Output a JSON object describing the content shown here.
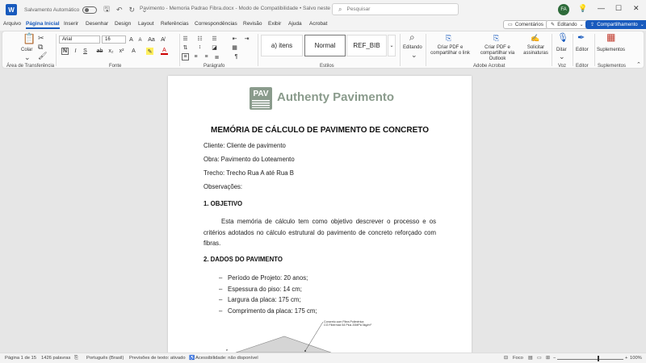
{
  "titlebar": {
    "autosave": "Salvamento Automático",
    "doc_title": "Pavimento - Memoria Padrao Fibra.docx  -  Modo de Compatibilidade • Salvo neste PC",
    "search_placeholder": "Pesquisar",
    "avatar_initials": "FA"
  },
  "tabs": [
    "Arquivo",
    "Página Inicial",
    "Inserir",
    "Desenhar",
    "Design",
    "Layout",
    "Referências",
    "Correspondências",
    "Revisão",
    "Exibir",
    "Ajuda",
    "Acrobat"
  ],
  "active_tab": "Página Inicial",
  "actions": {
    "comments": "Comentários",
    "editing": "Editando",
    "share": "Compartilhamento"
  },
  "ribbon": {
    "clipboard": {
      "paste": "Colar",
      "label": "Área de Transferência"
    },
    "font": {
      "name": "Arial",
      "size": "16",
      "label": "Fonte"
    },
    "paragraph": {
      "label": "Parágrafo"
    },
    "styles": {
      "items": [
        "a)  itens",
        "Normal",
        "REF_BIB"
      ],
      "label": "Estilos"
    },
    "editing": {
      "btn": "Editando"
    },
    "acrobat": {
      "create_pdf": "Criar PDF e compartilhar o link",
      "create_outlook": "Criar PDF e compartilhar via Outlook",
      "signatures": "Solicitar assinaturas",
      "label": "Adobe Acrobat"
    },
    "voice": {
      "btn": "Ditar",
      "label": "Voz"
    },
    "editor": {
      "btn": "Editor",
      "label": "Editor"
    },
    "addins": {
      "btn": "Suplementos",
      "label": "Suplementos"
    }
  },
  "document": {
    "logo_badge": "PAV",
    "logo_text": "Authenty Pavimento",
    "heading": "MEMÓRIA DE CÁLCULO DE PAVIMENTO DE CONCRETO",
    "client": "Cliente: Cliente de pavimento",
    "work": "Obra: Pavimento do Loteamento",
    "section": "Trecho: Trecho Rua A até Rua B",
    "notes": "Observações:",
    "sec1_title": "1.  OBJETIVO",
    "sec1_text": "Esta memória de cálculo tem como objetivo descrever o processo e os critérios adotados no cálculo estrutural do pavimento de concreto reforçado com fibras.",
    "sec2_title": "2.  DADOS DO PAVIMENTO",
    "items": [
      "Período de Projeto: 20 anos;",
      "Espessura do piso: 14 cm;",
      "Largura da placa: 175 cm;",
      "Comprimento da placa: 175 cm;"
    ],
    "figure_label_1": "Concreto com Fibra Polimérica",
    "figure_label_2": "CG Fibermax 54 Plus 20MPa 0kg/m³"
  },
  "status": {
    "page": "Página 1 de 15",
    "words": "1426 palavras",
    "language": "Português (Brasil)",
    "predictions": "Previsões de texto: ativado",
    "accessibility": "Acessibilidade: não disponível",
    "focus": "Foco",
    "zoom": "100%"
  }
}
